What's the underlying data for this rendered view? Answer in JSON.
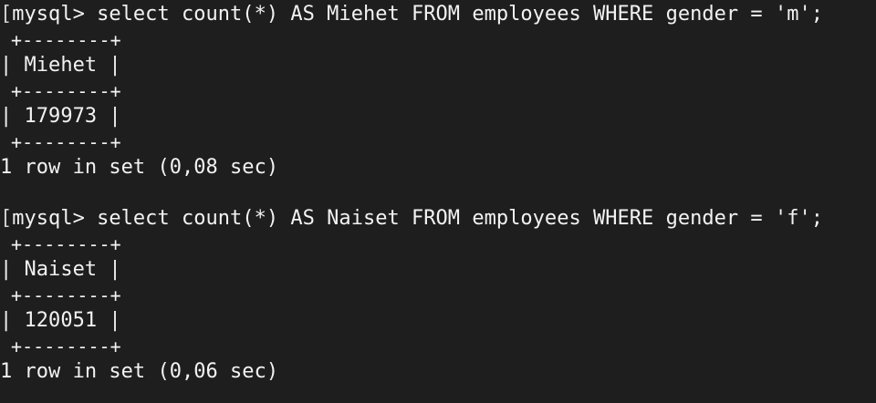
{
  "colors": {
    "background": "#1e1e1e",
    "text": "#f2f2f2"
  },
  "terminal": {
    "lines": [
      {
        "kind": "command",
        "bracket": "[",
        "text": "mysql> select count(*) AS Miehet FROM employees WHERE gender = 'm';"
      },
      {
        "kind": "rule",
        "text": " +--------+"
      },
      {
        "kind": "text",
        "text": "| Miehet |"
      },
      {
        "kind": "rule",
        "text": " +--------+"
      },
      {
        "kind": "text",
        "text": "| 179973 |"
      },
      {
        "kind": "rule",
        "text": " +--------+"
      },
      {
        "kind": "text",
        "text": "1 row in set (0,08 sec)"
      },
      {
        "kind": "blank",
        "text": ""
      },
      {
        "kind": "command",
        "bracket": "[",
        "text": "mysql> select count(*) AS Naiset FROM employees WHERE gender = 'f';"
      },
      {
        "kind": "rule",
        "text": " +--------+"
      },
      {
        "kind": "text",
        "text": "| Naiset |"
      },
      {
        "kind": "rule",
        "text": " +--------+"
      },
      {
        "kind": "text",
        "text": "| 120051 |"
      },
      {
        "kind": "rule",
        "text": " +--------+"
      },
      {
        "kind": "text",
        "text": "1 row in set (0,06 sec)"
      }
    ]
  }
}
